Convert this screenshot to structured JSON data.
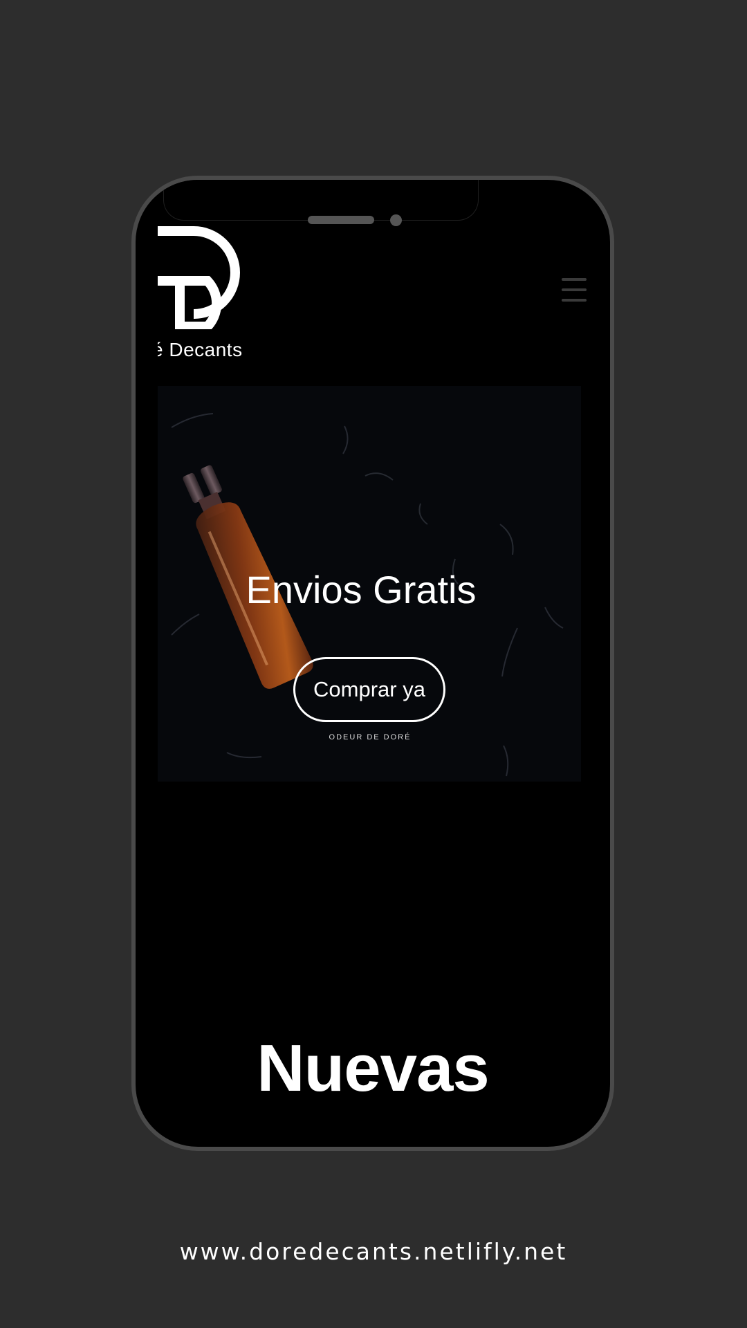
{
  "header": {
    "brand_name": "é Decants",
    "menu_icon": "hamburger-menu-icon",
    "logo_icon": "dd-monogram-logo"
  },
  "hero": {
    "title": "Envios Gratis",
    "cta_label": "Comprar ya",
    "tagline": "ODEUR DE DORÉ",
    "image": "perfume-bottle-on-dark-marble"
  },
  "section": {
    "title": "Nuevas"
  },
  "footer": {
    "url": "www.doredecants.netlifly.net"
  },
  "colors": {
    "background": "#2d2d2d",
    "phone_frame": "#4a4a4a",
    "screen": "#000000",
    "text": "#ffffff"
  }
}
